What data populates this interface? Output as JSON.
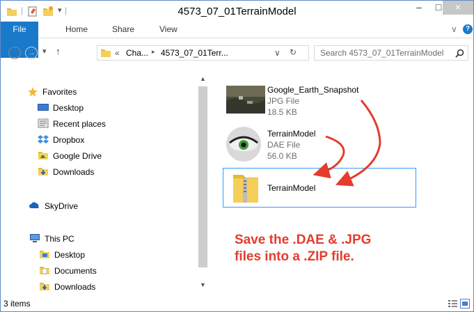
{
  "window": {
    "title": "4573_07_01TerrainModel",
    "minimize": "–",
    "maximize": "□",
    "close": "×"
  },
  "ribbon": {
    "tabs": [
      "File",
      "Home",
      "Share",
      "View"
    ],
    "collapse": "∨",
    "help": "?"
  },
  "address": {
    "back": "←",
    "forward": "→",
    "recent": "▾",
    "up": "↑",
    "overflow": "«",
    "crumbs": [
      "Cha...",
      "4573_07_01Terr..."
    ],
    "sep": "▸",
    "dropdown": "∨",
    "refresh": "↻"
  },
  "search": {
    "placeholder": "Search 4573_07_01TerrainModel"
  },
  "nav": {
    "favorites": {
      "label": "Favorites",
      "items": [
        "Desktop",
        "Recent places",
        "Dropbox",
        "Google Drive",
        "Downloads"
      ]
    },
    "skydrive": "SkyDrive",
    "thispc": {
      "label": "This PC",
      "items": [
        "Desktop",
        "Documents",
        "Downloads"
      ]
    }
  },
  "files": [
    {
      "name": "Google_Earth_Snapshot",
      "type": "JPG File",
      "size": "18.5 KB"
    },
    {
      "name": "TerrainModel",
      "type": "DAE File",
      "size": "56.0 KB"
    },
    {
      "name": "TerrainModel"
    }
  ],
  "annotation": {
    "line1": "Save the .DAE & .JPG",
    "line2": "files into a .ZIP file.",
    "color": "#e53c2d"
  },
  "status": {
    "count": "3 items"
  },
  "colors": {
    "accent": "#1979ca",
    "selection": "#3399ff",
    "folder": "#e8b92f"
  }
}
